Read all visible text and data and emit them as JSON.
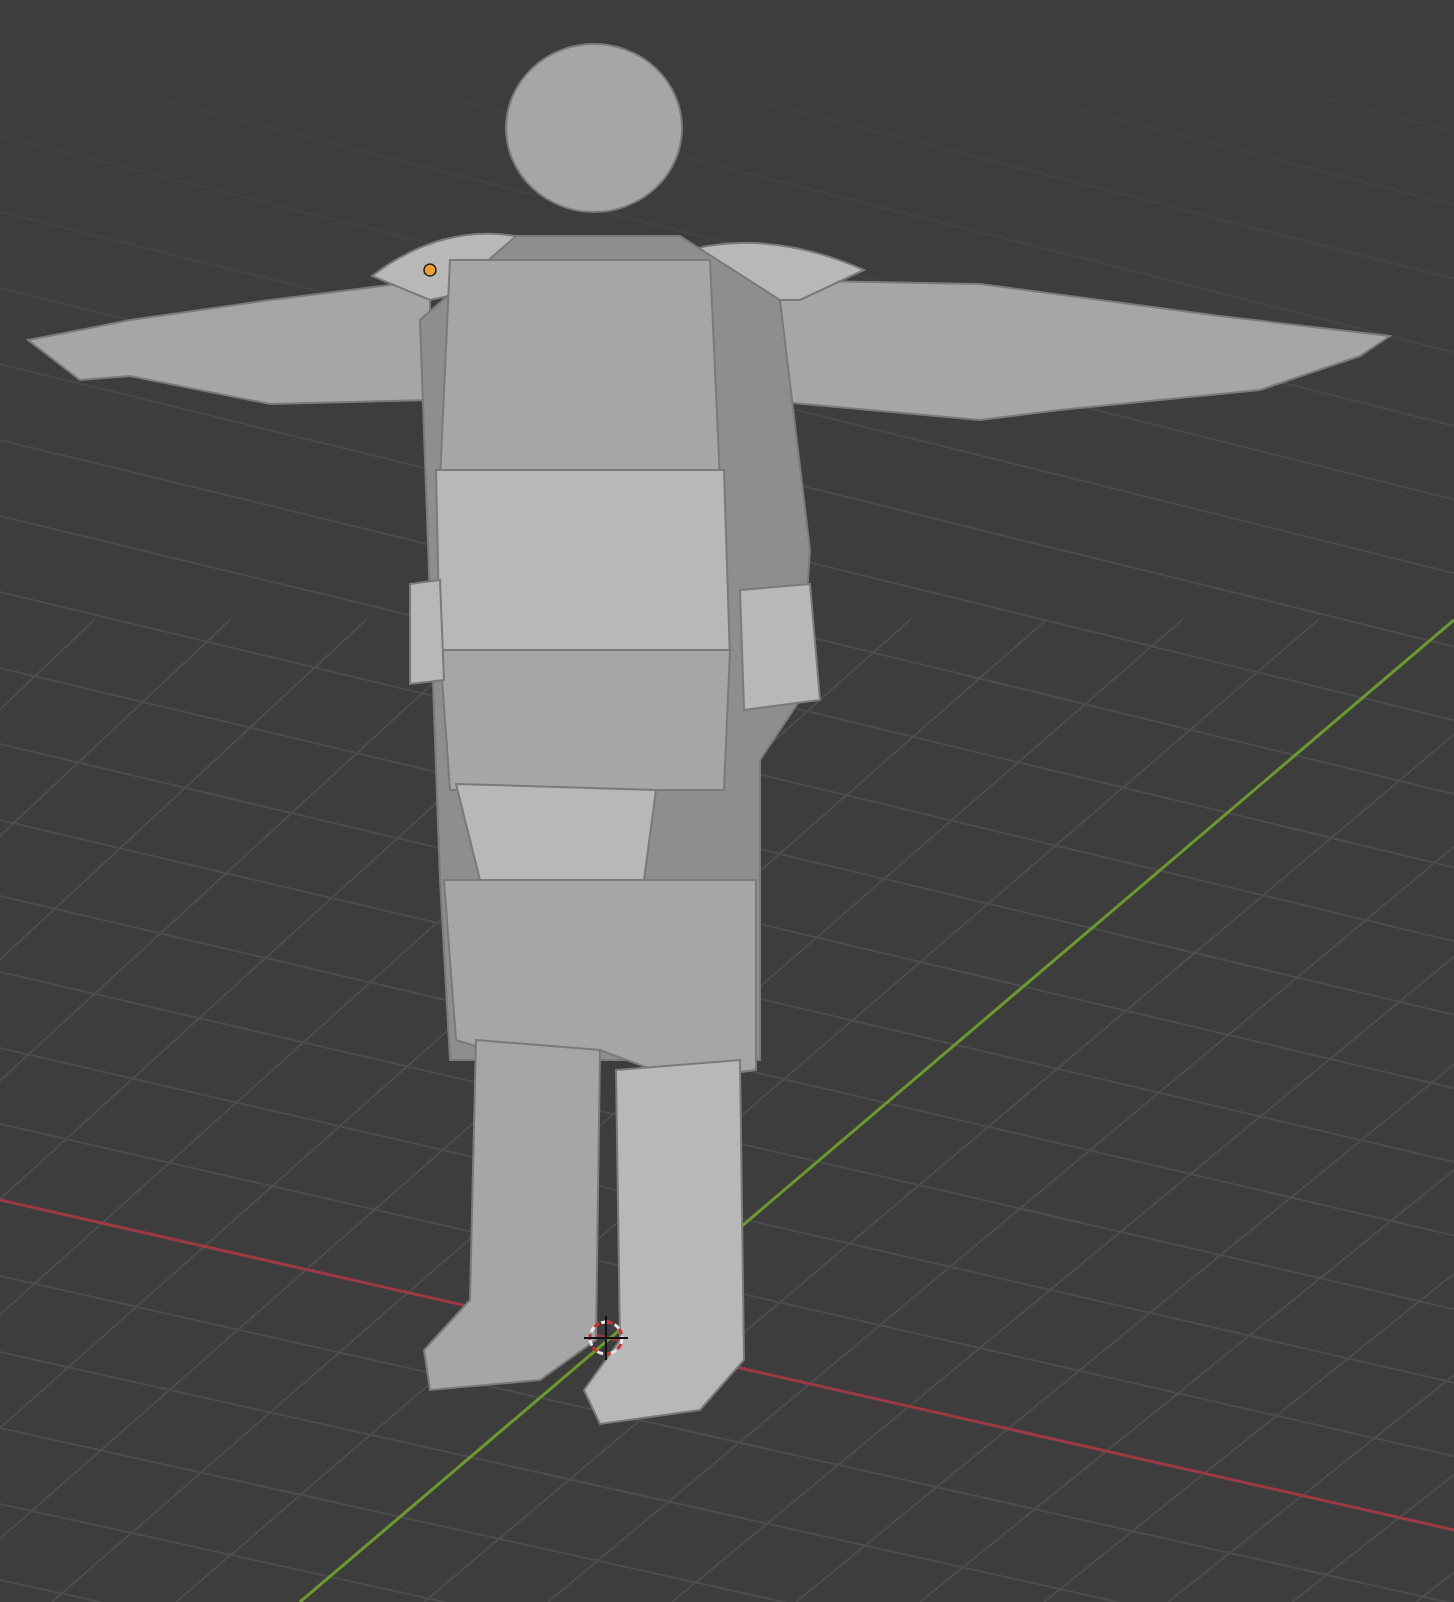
{
  "viewport": {
    "axes": [
      {
        "kind": "x",
        "color": "#9c3a44"
      },
      {
        "kind": "y",
        "color": "#6b9a2c"
      }
    ]
  }
}
